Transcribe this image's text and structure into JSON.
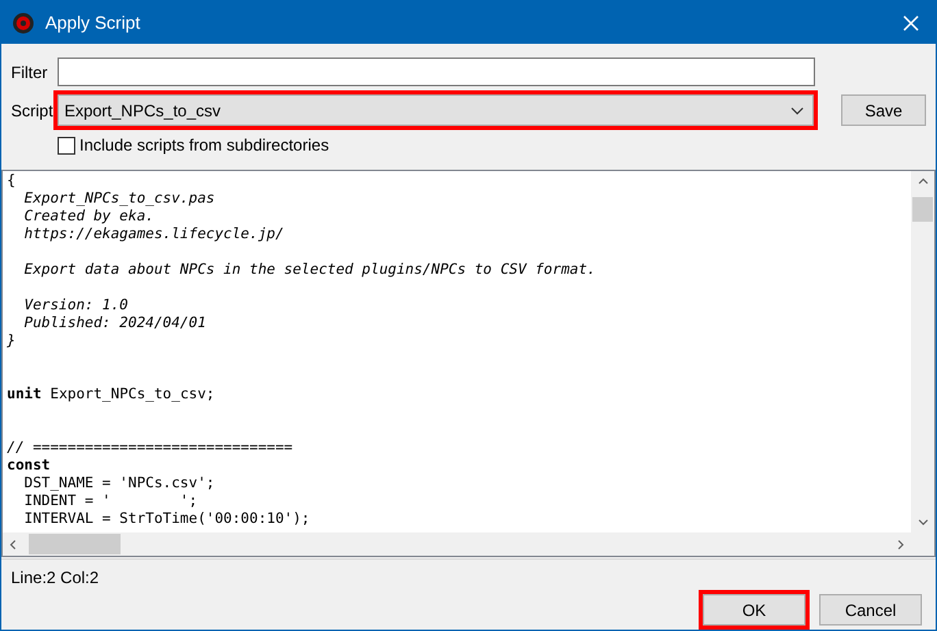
{
  "window": {
    "title": "Apply Script"
  },
  "filter": {
    "label": "Filter"
  },
  "script": {
    "label": "Script",
    "value": "Export_NPCs_to_csv",
    "highlighted": true
  },
  "save_button": {
    "label": "Save"
  },
  "include_subdirs": {
    "label": "Include scripts from subdirectories",
    "checked": false
  },
  "editor": {
    "lines": [
      {
        "kind": "code",
        "text": "{"
      },
      {
        "kind": "comment",
        "text": "  Export_NPCs_to_csv.pas"
      },
      {
        "kind": "comment",
        "text": "  Created by eka."
      },
      {
        "kind": "comment",
        "text": "  https://ekagames.lifecycle.jp/"
      },
      {
        "kind": "blank"
      },
      {
        "kind": "comment",
        "text": "  Export data about NPCs in the selected plugins/NPCs to CSV format."
      },
      {
        "kind": "blank"
      },
      {
        "kind": "comment",
        "text": "  Version: 1.0"
      },
      {
        "kind": "comment",
        "text": "  Published: 2024/04/01"
      },
      {
        "kind": "comment",
        "text": "}"
      },
      {
        "kind": "blank"
      },
      {
        "kind": "blank"
      },
      {
        "kind": "code",
        "text": "**unit** Export_NPCs_to_csv;"
      },
      {
        "kind": "blank"
      },
      {
        "kind": "blank"
      },
      {
        "kind": "comment",
        "text": "// =============================="
      },
      {
        "kind": "code",
        "text": "**const**"
      },
      {
        "kind": "code",
        "text": "  DST_NAME = 'NPCs.csv';"
      },
      {
        "kind": "code",
        "text": "  INDENT = '        ';"
      },
      {
        "kind": "code",
        "text": "  INTERVAL = StrToTime('00:00:10');"
      }
    ]
  },
  "status_bar": {
    "text": "Line:2 Col:2"
  },
  "buttons": [
    {
      "label": "OK",
      "highlighted": true
    },
    {
      "label": "Cancel",
      "highlighted": false
    }
  ]
}
